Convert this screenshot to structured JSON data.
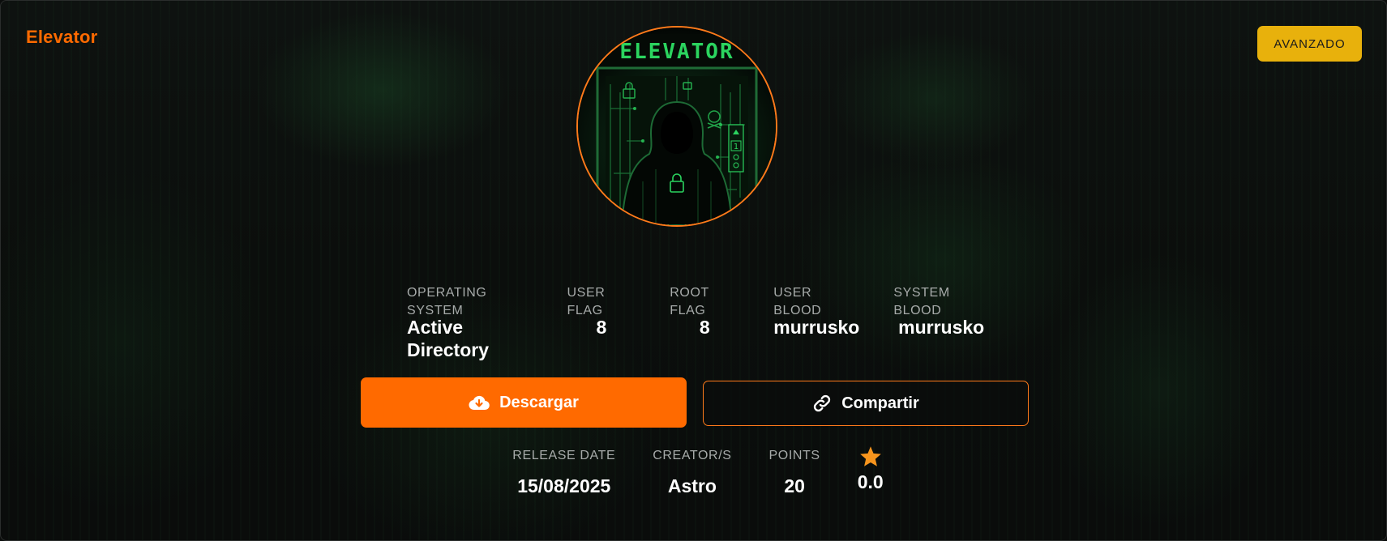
{
  "brand": {
    "title": "Elevator"
  },
  "header": {
    "difficulty_badge": "AVANZADO"
  },
  "avatar": {
    "sign_text": "ELEVATOR"
  },
  "stats": [
    {
      "label": "OPERATING SYSTEM",
      "value": "Active Directory"
    },
    {
      "label": "USER FLAG",
      "value": "8"
    },
    {
      "label": "ROOT FLAG",
      "value": "8"
    },
    {
      "label": "USER BLOOD",
      "value": "murrusko"
    },
    {
      "label": "SYSTEM BLOOD",
      "value": "murrusko"
    }
  ],
  "actions": {
    "download_label": "Descargar",
    "download_icon": "cloud-download-icon",
    "share_label": "Compartir",
    "share_icon": "link-icon"
  },
  "meta": {
    "release_date_label": "RELEASE DATE",
    "release_date": "15/08/2025",
    "creator_label": "CREATOR/S",
    "creator": "Astro",
    "points_label": "POINTS",
    "points": "20",
    "rating_icon": "star-icon",
    "rating": "0.0"
  },
  "colors": {
    "accent": "#ff6a00",
    "badge": "#e8b10c",
    "star": "#f7941d",
    "neon_green": "#2bd45f"
  }
}
